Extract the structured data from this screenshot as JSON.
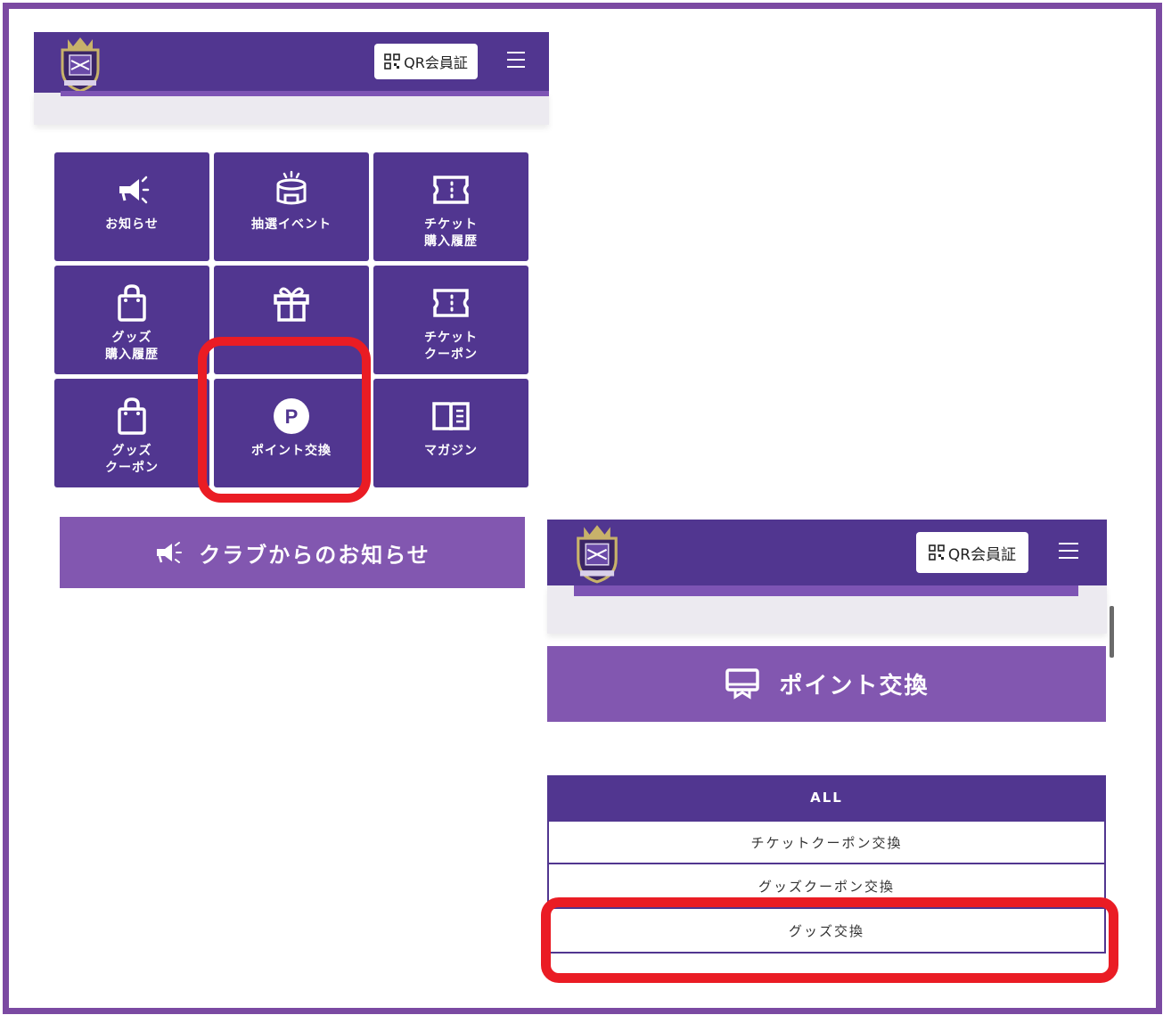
{
  "header": {
    "qr_label": "QR会員証",
    "logo_icon": "club-crest-logo",
    "menu_icon": "hamburger-menu-icon",
    "color_primary": "#513690",
    "color_secondary": "#8257b0"
  },
  "menu_tiles": [
    {
      "label": "お知らせ",
      "icon": "megaphone-icon"
    },
    {
      "label": "抽選イベント",
      "icon": "lottery-drum-icon"
    },
    {
      "label": "チケット\n購入履歴",
      "icon": "ticket-icon"
    },
    {
      "label": "グッズ\n購入履歴",
      "icon": "shopping-bag-icon"
    },
    {
      "label": "",
      "icon": "gift-icon"
    },
    {
      "label": "チケット\nクーポン",
      "icon": "ticket-icon"
    },
    {
      "label": "グッズ\nクーポン",
      "icon": "shopping-bag-icon"
    },
    {
      "label": "ポイント交換",
      "icon": "points-p-icon"
    },
    {
      "label": "マガジン",
      "icon": "open-book-icon"
    }
  ],
  "notice_banner": {
    "label": "クラブからのお知らせ",
    "icon": "megaphone-icon"
  },
  "points_page": {
    "title": "ポイント交換",
    "title_icon": "kiosk-monitor-icon",
    "tabs": [
      "ALL",
      "チケットクーポン交換",
      "グッズクーポン交換",
      "グッズ交換"
    ],
    "active_tab": "ALL"
  },
  "highlight_color": "#ea1c24"
}
